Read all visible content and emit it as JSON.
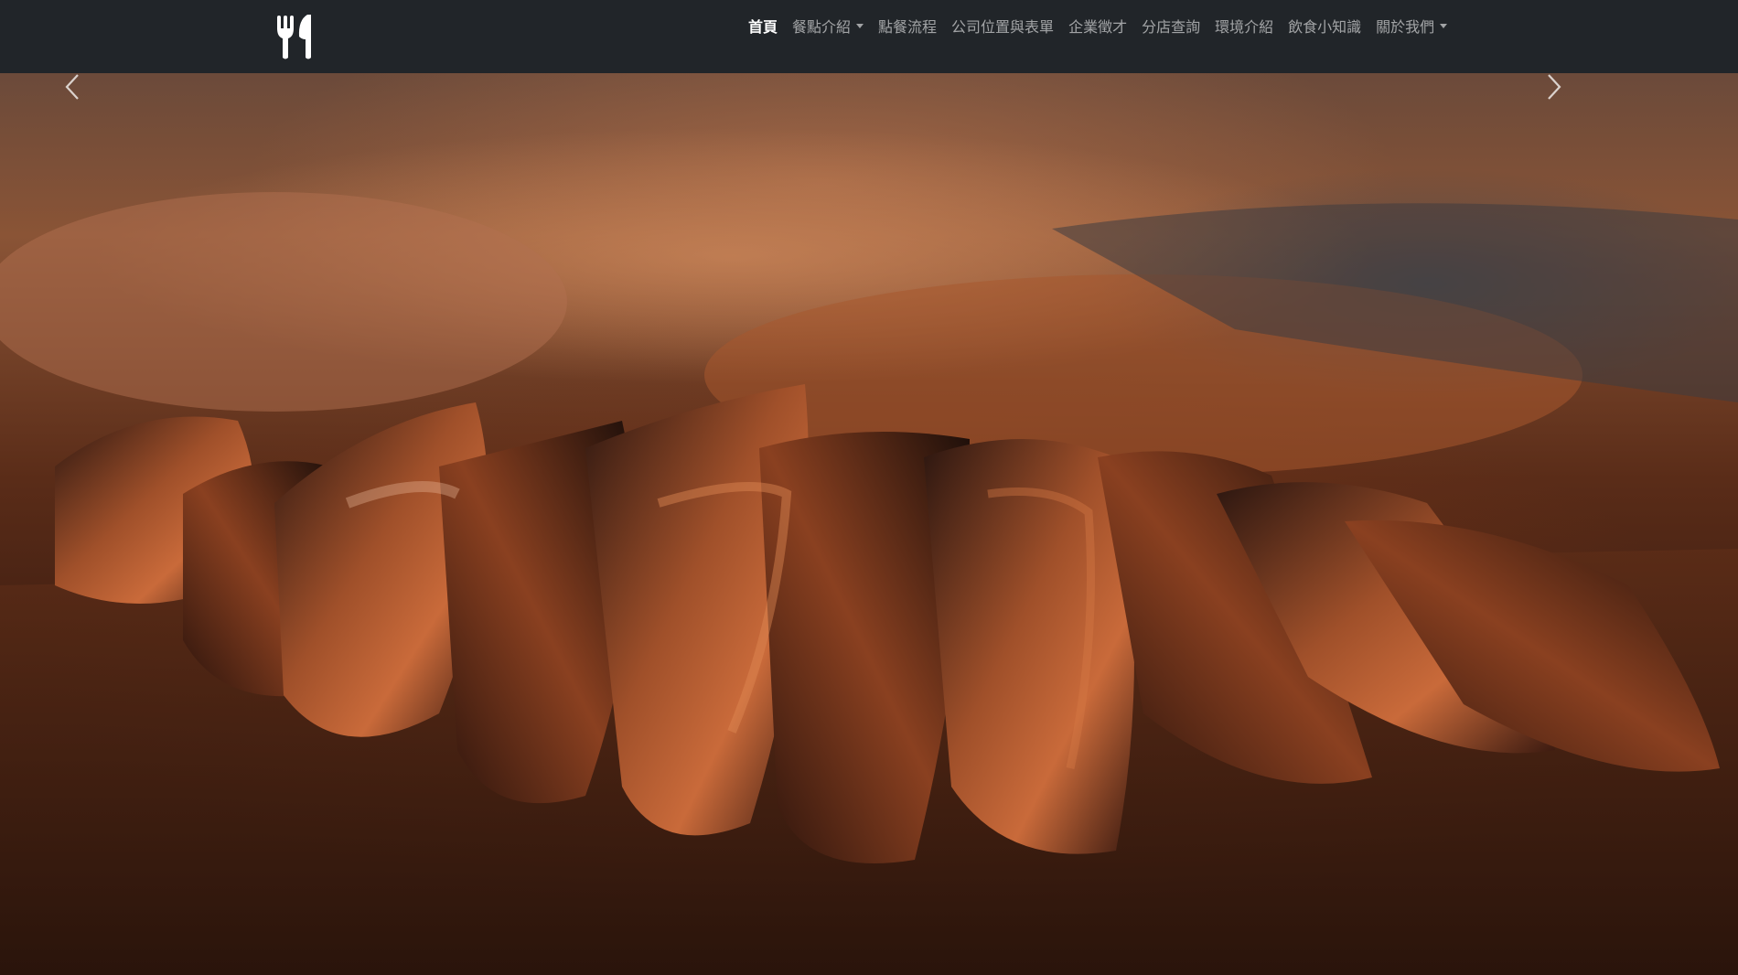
{
  "navbar": {
    "brand_icon": "fork-knife-icon",
    "links": [
      {
        "label": "首頁",
        "active": true,
        "dropdown": false
      },
      {
        "label": "餐點介紹",
        "active": false,
        "dropdown": true
      },
      {
        "label": "點餐流程",
        "active": false,
        "dropdown": false
      },
      {
        "label": "公司位置與表單",
        "active": false,
        "dropdown": false
      },
      {
        "label": "企業徵才",
        "active": false,
        "dropdown": false
      },
      {
        "label": "分店查詢",
        "active": false,
        "dropdown": false
      },
      {
        "label": "環境介紹",
        "active": false,
        "dropdown": false
      },
      {
        "label": "飲食小知識",
        "active": false,
        "dropdown": false
      },
      {
        "label": "關於我們",
        "active": false,
        "dropdown": true
      }
    ]
  },
  "carousel": {
    "slide_image": "sliced-grilled-steak-on-wooden-board",
    "prev_icon": "chevron-left-icon",
    "next_icon": "chevron-right-icon"
  },
  "colors": {
    "navbar_bg": "#212529",
    "active_link": "#ffffff",
    "inactive_link": "rgba(255,255,255,0.58)"
  }
}
